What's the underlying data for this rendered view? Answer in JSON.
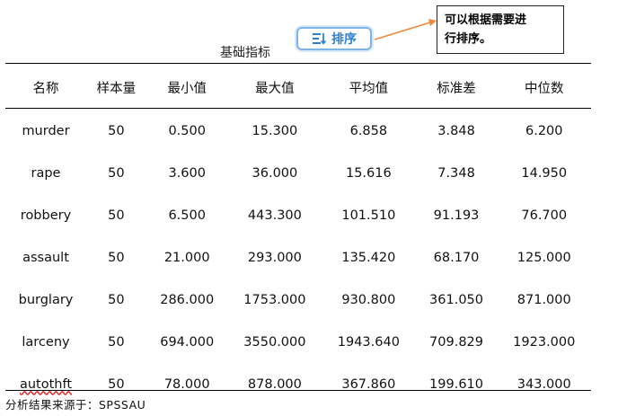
{
  "table_title": "基础指标",
  "sort_button": {
    "label": "排序",
    "icon": "sort-lines-icon",
    "color": "#2f7fd0"
  },
  "note": {
    "line1": "可以根据需要进",
    "line2": "行排序。"
  },
  "columns": [
    "名称",
    "样本量",
    "最小值",
    "最大值",
    "平均值",
    "标准差",
    "中位数"
  ],
  "rows": [
    [
      "murder",
      "50",
      "0.500",
      "15.300",
      "6.858",
      "3.848",
      "6.200"
    ],
    [
      "rape",
      "50",
      "3.600",
      "36.000",
      "15.616",
      "7.348",
      "14.950"
    ],
    [
      "robbery",
      "50",
      "6.500",
      "443.300",
      "101.510",
      "91.193",
      "76.700"
    ],
    [
      "assault",
      "50",
      "21.000",
      "293.000",
      "135.420",
      "68.170",
      "125.000"
    ],
    [
      "burglary",
      "50",
      "286.000",
      "1753.000",
      "930.800",
      "361.050",
      "871.000"
    ],
    [
      "larceny",
      "50",
      "694.000",
      "3550.000",
      "1943.640",
      "709.829",
      "1923.000"
    ],
    [
      "autothft",
      "50",
      "78.000",
      "878.000",
      "367.860",
      "199.610",
      "343.000"
    ]
  ],
  "footer": "分析结果来源于：SPSSAU",
  "colors": {
    "arrow": "#f0873a",
    "button_border": "#7fb4e6"
  }
}
